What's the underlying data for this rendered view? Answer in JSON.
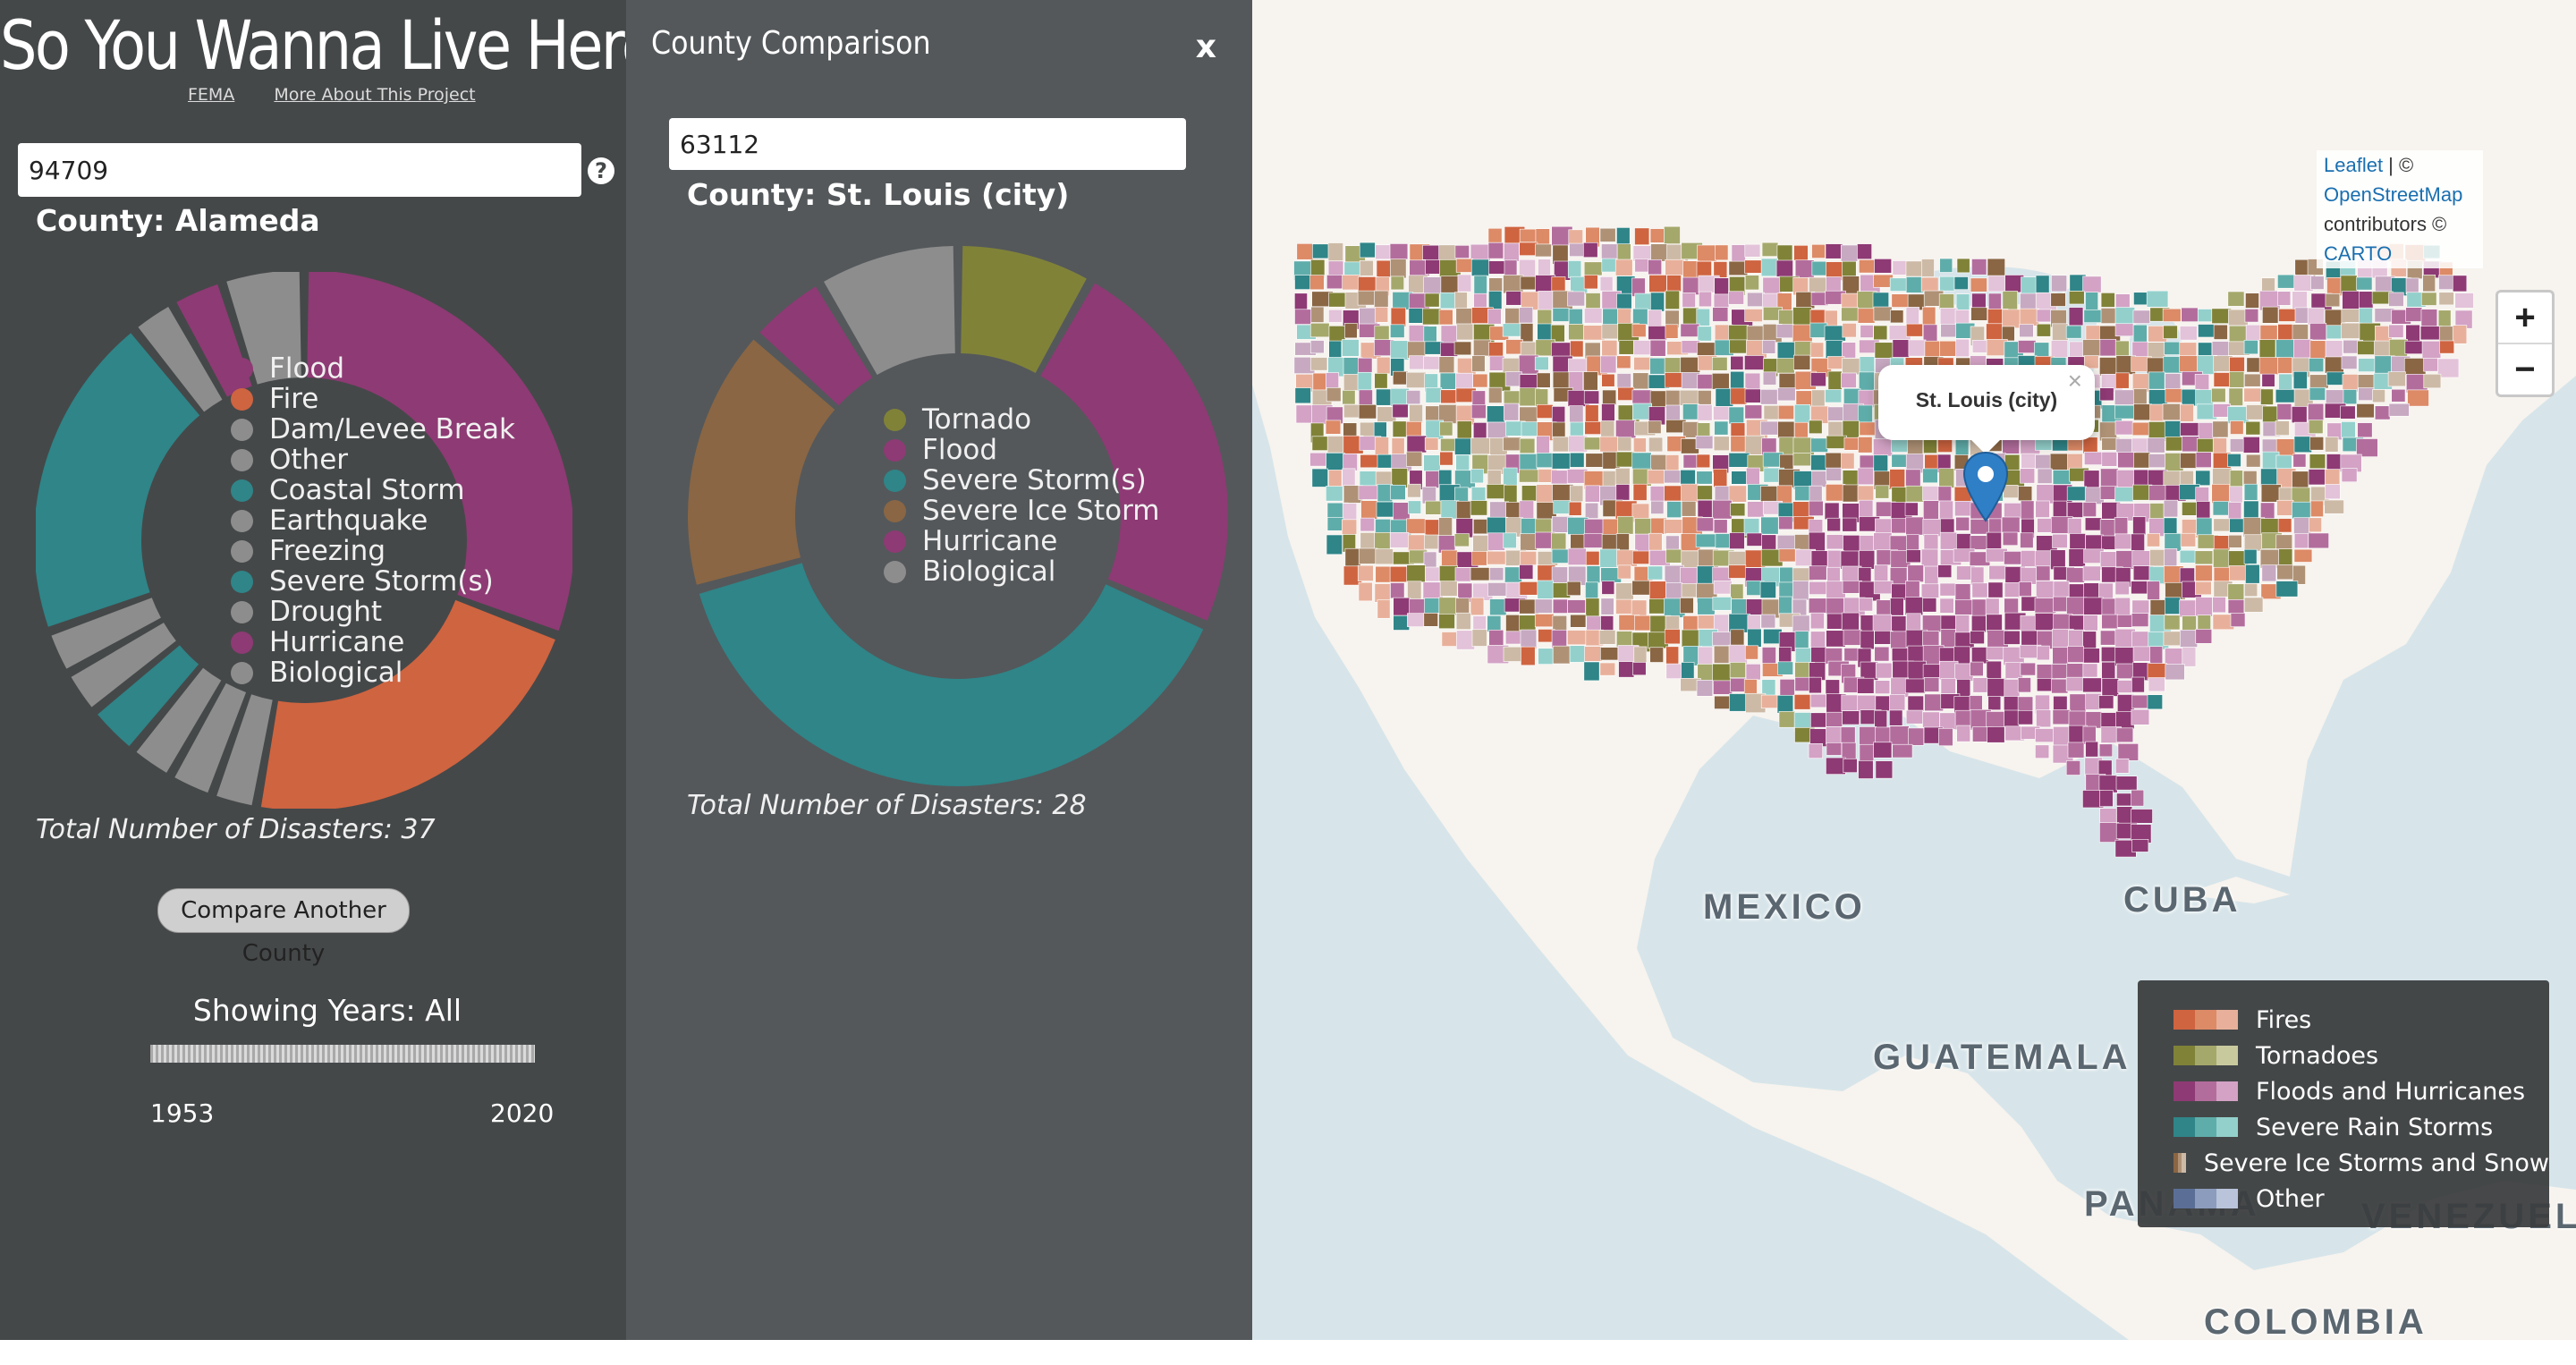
{
  "app": {
    "title": "So You Wanna Live Here?",
    "links": [
      "FEMA",
      "More About This Project"
    ]
  },
  "primary": {
    "zip": "94709",
    "help": "?",
    "county": "County: Alameda",
    "total": "Total Number of Disasters: 37",
    "legend": [
      {
        "label": "Flood",
        "color": "#8e3a74"
      },
      {
        "label": "Fire",
        "color": "#cf6440"
      },
      {
        "label": "Dam/Levee Break",
        "color": "#8d8d8d"
      },
      {
        "label": "Other",
        "color": "#8d8d8d"
      },
      {
        "label": "Coastal Storm",
        "color": "#2f8588"
      },
      {
        "label": "Earthquake",
        "color": "#8d8d8d"
      },
      {
        "label": "Freezing",
        "color": "#8d8d8d"
      },
      {
        "label": "Severe Storm(s)",
        "color": "#2f8588"
      },
      {
        "label": "Drought",
        "color": "#8d8d8d"
      },
      {
        "label": "Hurricane",
        "color": "#8e3a74"
      },
      {
        "label": "Biological",
        "color": "#8d8d8d"
      }
    ],
    "compare_button": "Compare Another County",
    "years_title": "Showing Years: All",
    "year_start": "1953",
    "year_end": "2020"
  },
  "comparison": {
    "heading": "County Comparison",
    "close": "x",
    "zip": "63112",
    "county": "County: St. Louis (city)",
    "total": "Total Number of Disasters: 28",
    "legend": [
      {
        "label": "Tornado",
        "color": "#808238"
      },
      {
        "label": "Flood",
        "color": "#8e3a74"
      },
      {
        "label": "Severe Storm(s)",
        "color": "#2f8588"
      },
      {
        "label": "Severe Ice Storm",
        "color": "#8a6644"
      },
      {
        "label": "Hurricane",
        "color": "#8e3a74"
      },
      {
        "label": "Biological",
        "color": "#8d8d8d"
      }
    ]
  },
  "map": {
    "attribution": {
      "leaflet": "Leaflet",
      "sep": " | ©",
      "osm": "OpenStreetMap",
      "contrib": "contributors ©",
      "carto": "CARTO"
    },
    "zoom_in": "+",
    "zoom_out": "−",
    "popup": "St. Louis (city)",
    "popup_close": "×",
    "labels": {
      "mexico": "MEXICO",
      "cuba": "CUBA",
      "guatemala": "GUATEMALA",
      "panama": "PANAMA",
      "venezuela": "VENEZUELA",
      "colombia": "COLOMBIA"
    },
    "legend": [
      {
        "label": "Fires",
        "colors": [
          "#cf6440",
          "#dd8a67",
          "#e8b09a"
        ]
      },
      {
        "label": "Tornadoes",
        "colors": [
          "#808238",
          "#a5a86b",
          "#c8ca9e"
        ]
      },
      {
        "label": "Floods and Hurricanes",
        "colors": [
          "#8e3a74",
          "#b36d9d",
          "#d3a2c5"
        ]
      },
      {
        "label": "Severe Rain Storms",
        "colors": [
          "#2f8588",
          "#5fadaa",
          "#93d0cc"
        ]
      },
      {
        "label": "Severe Ice Storms and Snow",
        "colors": [
          "#8a6644",
          "#af9276",
          "#cdbaa6"
        ]
      },
      {
        "label": "Other",
        "colors": [
          "#5b6f96",
          "#8c9cbc",
          "#b9c4db"
        ]
      }
    ]
  }
}
